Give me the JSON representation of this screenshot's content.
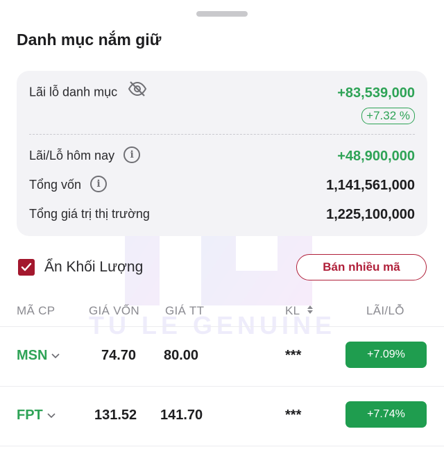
{
  "sheet": {
    "title": "Danh mục nắm giữ"
  },
  "summary": {
    "portfolio_pl_label": "Lãi lỗ danh mục",
    "portfolio_pl_value": "+83,539,000",
    "portfolio_pl_pct": "+7.32 %",
    "today_pl_label": "Lãi/Lỗ hôm nay",
    "today_pl_value": "+48,900,000",
    "capital_label": "Tổng vốn",
    "capital_value": "1,141,561,000",
    "market_value_label": "Tổng giá trị thị trường",
    "market_value_value": "1,225,100,000"
  },
  "controls": {
    "hide_volume_label": "Ẩn Khối Lượng",
    "hide_volume_checked": true,
    "sell_multiple_label": "Bán nhiều mã"
  },
  "table": {
    "headers": {
      "symbol": "MÃ CP",
      "cost_price": "GIÁ VỐN",
      "market_price": "GIÁ TT",
      "volume": "KL",
      "pl": "LÃI/LỖ"
    },
    "rows": [
      {
        "symbol": "MSN",
        "cost_price": "74.70",
        "market_price": "80.00",
        "volume": "***",
        "pl": "+7.09%"
      },
      {
        "symbol": "FPT",
        "cost_price": "131.52",
        "market_price": "141.70",
        "volume": "***",
        "pl": "+7.74%"
      }
    ]
  },
  "watermark": {
    "text": "TU LE GENUINE"
  },
  "colors": {
    "positive": "#2ea356",
    "positive_badge": "#1f9d4f",
    "accent": "#b0203a",
    "card_bg": "#f3f3f6"
  },
  "icons": {
    "hide_eye": "eye-off-icon",
    "info": "info-icon",
    "sort": "sort-icon",
    "chevron": "chevron-down-icon",
    "check": "check-icon"
  }
}
